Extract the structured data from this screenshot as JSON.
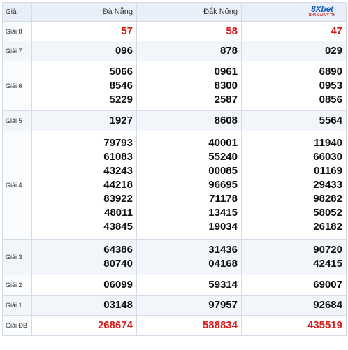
{
  "header": {
    "prize_col": "Giải",
    "provinces": [
      "Đà Nẵng",
      "Đắk Nông"
    ],
    "logo_text": "8Xbet",
    "logo_tagline": "NHÀ CÁI UY TÍN"
  },
  "rows": {
    "g8": {
      "label": "Giải 8",
      "values": [
        "57",
        "58",
        "47"
      ]
    },
    "g7": {
      "label": "Giải 7",
      "values": [
        "096",
        "878",
        "029"
      ]
    },
    "g6": {
      "label": "Giải 6",
      "values": [
        [
          "5066",
          "8546",
          "5229"
        ],
        [
          "0961",
          "8300",
          "2587"
        ],
        [
          "6890",
          "0953",
          "0856"
        ]
      ]
    },
    "g5": {
      "label": "Giải 5",
      "values": [
        "1927",
        "8608",
        "5564"
      ]
    },
    "g4": {
      "label": "Giải 4",
      "values": [
        [
          "79793",
          "61083",
          "43243",
          "44218",
          "83922",
          "48011",
          "43845"
        ],
        [
          "40001",
          "55240",
          "00085",
          "96695",
          "71178",
          "13415",
          "19034"
        ],
        [
          "11940",
          "66030",
          "01169",
          "29433",
          "98282",
          "58052",
          "26182"
        ]
      ]
    },
    "g3": {
      "label": "Giải 3",
      "values": [
        [
          "64386",
          "80740"
        ],
        [
          "31436",
          "04168"
        ],
        [
          "90720",
          "42415"
        ]
      ]
    },
    "g2": {
      "label": "Giải 2",
      "values": [
        "06099",
        "59314",
        "69007"
      ]
    },
    "g1": {
      "label": "Giải 1",
      "values": [
        "03148",
        "97957",
        "92684"
      ]
    },
    "gdb": {
      "label": "Giải ĐB",
      "values": [
        "268674",
        "588834",
        "435519"
      ]
    }
  },
  "colors": {
    "highlight": "#d81b1b",
    "header_bg": "#e9eff9",
    "alt_row_bg": "#f2f5fa"
  }
}
